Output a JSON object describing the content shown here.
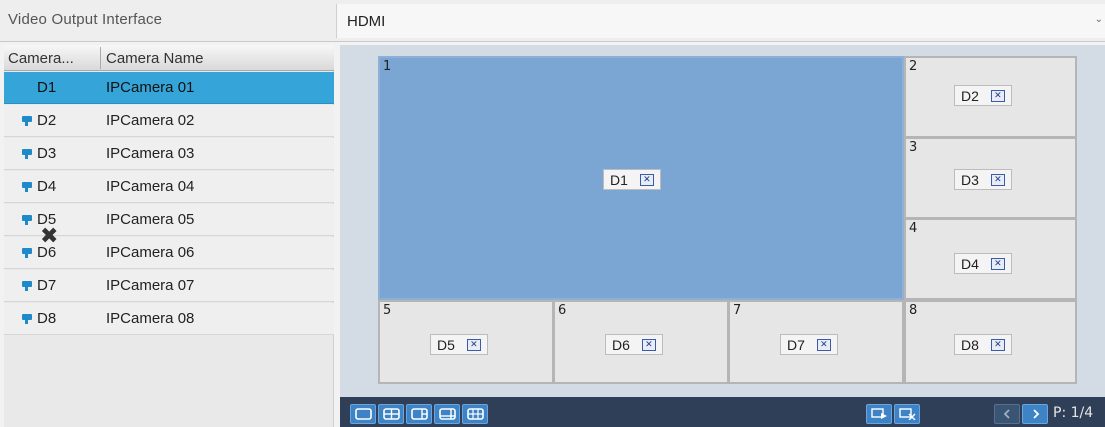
{
  "video_output": {
    "label": "Video Output Interface",
    "value": "HDMI"
  },
  "camera_list": {
    "header_col1": "Camera...",
    "header_col2": "Camera Name",
    "rows": [
      {
        "id": "D1",
        "name": "IPCamera 01",
        "selected": true
      },
      {
        "id": "D2",
        "name": "IPCamera 02"
      },
      {
        "id": "D3",
        "name": "IPCamera 03"
      },
      {
        "id": "D4",
        "name": "IPCamera 04"
      },
      {
        "id": "D5",
        "name": "IPCamera 05"
      },
      {
        "id": "D6",
        "name": "IPCamera 06"
      },
      {
        "id": "D7",
        "name": "IPCamera 07"
      },
      {
        "id": "D8",
        "name": "IPCamera 08"
      }
    ]
  },
  "layout": {
    "cells": [
      {
        "num": "1",
        "cam": "D1"
      },
      {
        "num": "2",
        "cam": "D2"
      },
      {
        "num": "3",
        "cam": "D3"
      },
      {
        "num": "4",
        "cam": "D4"
      },
      {
        "num": "5",
        "cam": "D5"
      },
      {
        "num": "6",
        "cam": "D6"
      },
      {
        "num": "7",
        "cam": "D7"
      },
      {
        "num": "8",
        "cam": "D8"
      }
    ]
  },
  "toolbar": {
    "page_indicator": "P: 1/4"
  },
  "colors": {
    "selected_row": "#35a4d8",
    "main_cell": "#7ba6d3",
    "toolbar_bg": "#2f3f57",
    "button_blue": "#3d83c6"
  }
}
